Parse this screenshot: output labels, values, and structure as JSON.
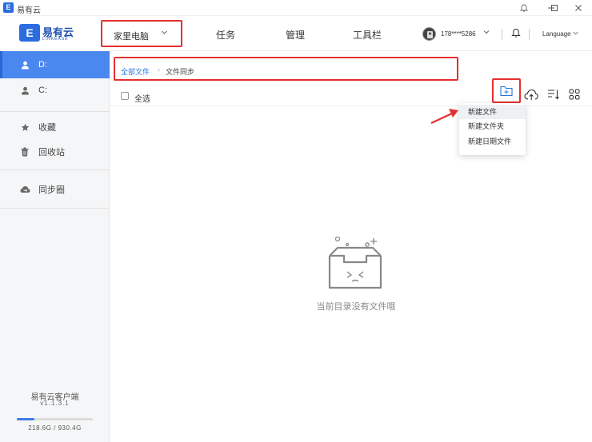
{
  "window": {
    "title": "易有云",
    "app_icon_glyph": "E"
  },
  "header": {
    "logo_glyph": "E",
    "logo_text": "易有云",
    "logo_sub": "LINKEASE",
    "device": "家里电脑",
    "tabs": [
      "任务",
      "管理",
      "工具栏"
    ],
    "user": "178****5286",
    "language": "Language"
  },
  "sidebar": {
    "drives": [
      {
        "label": "D:",
        "active": true
      },
      {
        "label": "C:",
        "active": false
      }
    ],
    "favorites_label": "收藏",
    "trash_label": "回收站",
    "sync_label": "同步圈",
    "client_name": "易有云客户端",
    "version": "v1.1.3.1",
    "storage_text": "218.6G / 930.4G",
    "storage_used_fraction": 0.235
  },
  "breadcrumb": {
    "root": "全部文件",
    "separator": "›",
    "current": "文件同步"
  },
  "toolbar": {
    "select_all": "全选"
  },
  "new_menu": {
    "items": [
      "新建文件",
      "新建文件夹",
      "新建日期文件"
    ],
    "hover_index": 0
  },
  "empty_state": {
    "message": "当前目录没有文件哦"
  },
  "colors": {
    "accent": "#2b6de0",
    "sidebar_active": "#4a87ef",
    "annotation_red": "#e53030"
  }
}
